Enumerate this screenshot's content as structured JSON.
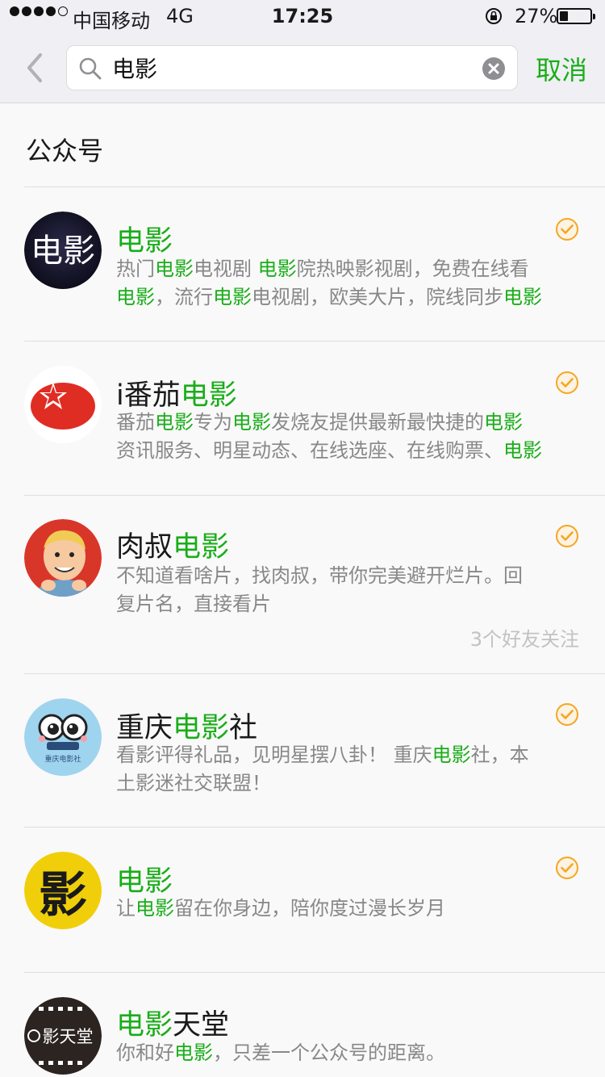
{
  "status_bar": {
    "carrier": "中国移动",
    "network": "4G",
    "time": "17:25",
    "battery_percent": "27%",
    "battery_level": 0.27
  },
  "search": {
    "query": "电影",
    "cancel_label": "取消"
  },
  "section": {
    "title": "公众号"
  },
  "results": [
    {
      "name_parts": [
        {
          "t": "电影",
          "hl": true
        }
      ],
      "desc_line1": [
        {
          "t": "热门",
          "hl": false
        },
        {
          "t": "电影",
          "hl": true
        },
        {
          "t": "电视剧 ",
          "hl": false
        },
        {
          "t": "电影",
          "hl": true
        },
        {
          "t": "院热映影视剧，免费在线看",
          "hl": false
        }
      ],
      "desc_line2": [
        {
          "t": "电影",
          "hl": true
        },
        {
          "t": "，流行",
          "hl": false
        },
        {
          "t": "电影",
          "hl": true
        },
        {
          "t": "电视剧，欧美大片，院线同步",
          "hl": false
        },
        {
          "t": "电影",
          "hl": true
        }
      ],
      "avatar": "movie-text-avatar",
      "verified": true
    },
    {
      "name_parts": [
        {
          "t": "i番茄",
          "hl": false
        },
        {
          "t": "电影",
          "hl": true
        }
      ],
      "desc_line1": [
        {
          "t": "番茄",
          "hl": false
        },
        {
          "t": "电影",
          "hl": true
        },
        {
          "t": "专为",
          "hl": false
        },
        {
          "t": "电影",
          "hl": true
        },
        {
          "t": "发烧友提供最新最快捷的",
          "hl": false
        },
        {
          "t": "电影",
          "hl": true
        }
      ],
      "desc_line2": [
        {
          "t": "资讯服务、明星动态、在线选座、在线购票、",
          "hl": false
        },
        {
          "t": "电影",
          "hl": true
        }
      ],
      "avatar": "tomato-avatar",
      "verified": true
    },
    {
      "name_parts": [
        {
          "t": "肉叔",
          "hl": false
        },
        {
          "t": "电影",
          "hl": true
        }
      ],
      "desc_line1": [
        {
          "t": "不知道看啥片，找肉叔，带你完美避开烂片。回",
          "hl": false
        }
      ],
      "desc_line2": [
        {
          "t": "复片名，直接看片",
          "hl": false
        }
      ],
      "friends": "3个好友关注",
      "avatar": "cartoon-man-avatar",
      "verified": true
    },
    {
      "name_parts": [
        {
          "t": "重庆",
          "hl": false
        },
        {
          "t": "电影",
          "hl": true
        },
        {
          "t": "社",
          "hl": false
        }
      ],
      "desc_line1": [
        {
          "t": "看影评得礼品，见明星摆八卦！ 重庆",
          "hl": false
        },
        {
          "t": "电影",
          "hl": true
        },
        {
          "t": "社，本",
          "hl": false
        }
      ],
      "desc_line2": [
        {
          "t": "土影迷社交联盟！",
          "hl": false
        }
      ],
      "avatar": "owl-eyes-avatar",
      "avatar_caption": "重庆电影社",
      "verified": true
    },
    {
      "name_parts": [
        {
          "t": "电影",
          "hl": true
        }
      ],
      "desc_line1": [
        {
          "t": "让",
          "hl": false
        },
        {
          "t": "电影",
          "hl": true
        },
        {
          "t": "留在你身边，陪你度过漫长岁月",
          "hl": false
        }
      ],
      "desc_line2": [],
      "avatar": "ying-character-avatar",
      "verified": true
    },
    {
      "name_parts": [
        {
          "t": "电影",
          "hl": true
        },
        {
          "t": "天堂",
          "hl": false
        }
      ],
      "desc_line1": [
        {
          "t": "你和好",
          "hl": false
        },
        {
          "t": "电影",
          "hl": true
        },
        {
          "t": "，只差一个公众号的距离。",
          "hl": false
        }
      ],
      "desc_line2": [],
      "avatar": "film-heaven-avatar",
      "avatar_caption": "影天堂",
      "verified": false
    }
  ],
  "colors": {
    "accent": "#1aad19",
    "secondary_text": "#888888",
    "verified": "#f5a623"
  }
}
